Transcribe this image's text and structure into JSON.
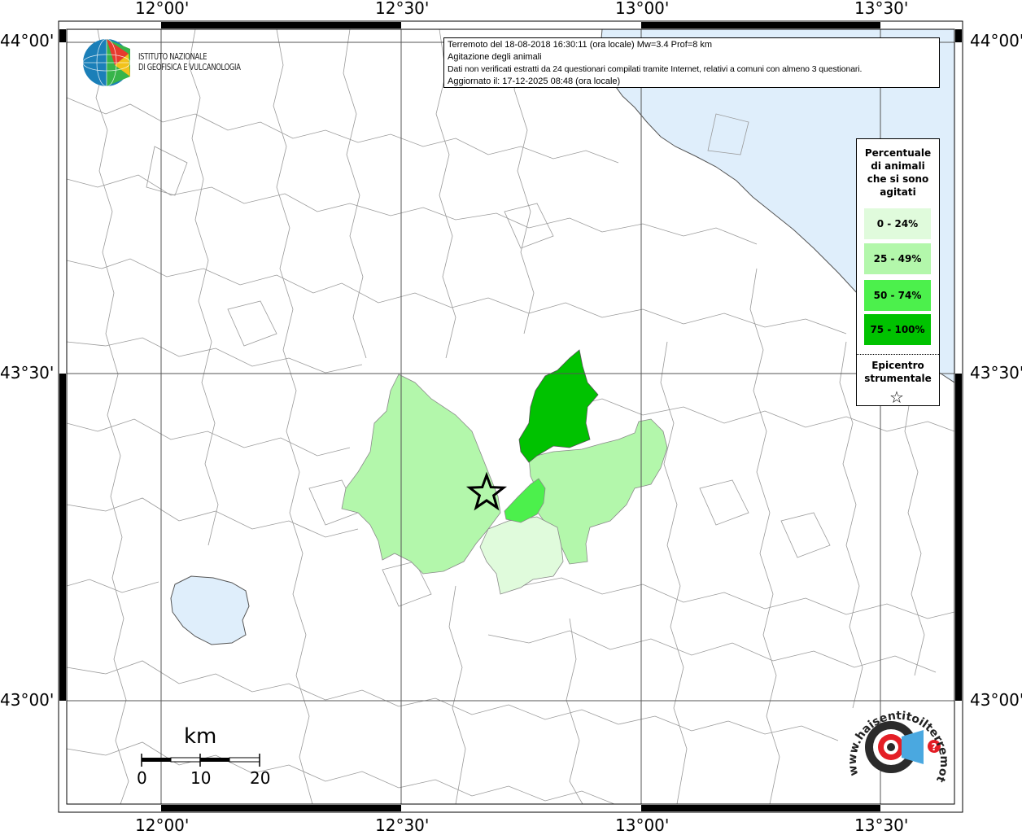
{
  "map": {
    "lon_labels": [
      "12°00'",
      "12°30'",
      "13°00'",
      "13°30'"
    ],
    "lat_labels": [
      "44°00'",
      "43°30'",
      "43°00'"
    ],
    "colors": {
      "land": "#ffffff",
      "water": "#dfeefb",
      "boundary": "#9a9a9a",
      "class_0_24": "#e0fbdc",
      "class_25_49": "#b3f7ab",
      "class_50_74": "#4cf04c",
      "class_75_100": "#00c200"
    }
  },
  "info": {
    "line1": "Terremoto del 18-08-2018 16:30:11 (ora locale) Mw=3.4 Prof=8 km",
    "line2": "Agitazione degli animali",
    "line3": "Dati non verificati estratti da 24 questionari compilati tramite Internet, relativi a comuni con almeno 3 questionari.",
    "line4": "Aggiornato il: 17-12-2025 08:48 (ora locale)"
  },
  "logo": {
    "line1": "ISTITUTO NAZIONALE",
    "line2": "DI GEOFISICA E VULCANOLOGIA"
  },
  "legend": {
    "title": [
      "Percentuale",
      "di animali",
      "che si sono",
      "agitati"
    ],
    "classes": [
      {
        "label": "0 - 24%",
        "color": "#e0fbdc"
      },
      {
        "label": "25 - 49%",
        "color": "#b3f7ab"
      },
      {
        "label": "50 - 74%",
        "color": "#4cf04c"
      },
      {
        "label": "75 - 100%",
        "color": "#00c200"
      }
    ],
    "epicenter": [
      "Epicentro",
      "strumentale"
    ],
    "epicenter_symbol": "☆"
  },
  "scale": {
    "title": "km",
    "labels": [
      "0",
      "10",
      "20"
    ]
  },
  "badge": {
    "text": "www.haisentitoilterremoto.it"
  }
}
